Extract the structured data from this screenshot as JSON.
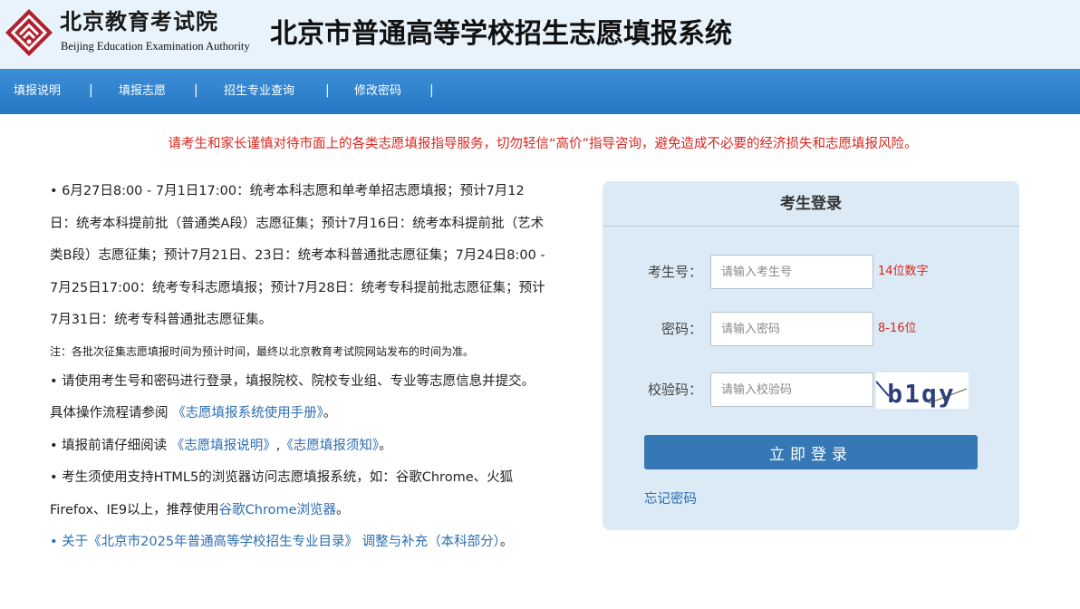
{
  "header": {
    "org_name_cn": "北京教育考试院",
    "org_name_en": "Beijing Education Examination Authority",
    "system_title": "北京市普通高等学校招生志愿填报系统",
    "logo_icon": "beijing-education-exam-logo-icon",
    "logo_color": "#b0212e"
  },
  "nav": {
    "items": [
      {
        "label": "填报说明"
      },
      {
        "label": "填报志愿"
      },
      {
        "label": "招生专业查询"
      },
      {
        "label": "修改密码"
      }
    ],
    "separator": "|",
    "background": "#2a7dc9"
  },
  "warning": "请考生和家长谨慎对待市面上的各类志愿填报指导服务，切勿轻信“高价”指导咨询，避免造成不必要的经济损失和志愿填报风险。",
  "notes": {
    "schedule": "• 6月27日8:00 - 7月1日17:00：统考本科志愿和单考单招志愿填报；预计7月12日：统考本科提前批（普通类A段）志愿征集；预计7月16日：统考本科提前批（艺术类B段）志愿征集；预计7月21日、23日：统考本科普通批志愿征集；7月24日8:00 - 7月25日17:00：统考专科志愿填报；预计7月28日：统考专科提前批志愿征集；预计7月31日：统考专科普通批志愿征集。",
    "note": "注：各批次征集志愿填报时间为预计时间，最终以北京教育考试院网站发布的时间为准。",
    "login_instruction_prefix": "• 请使用考生号和密码进行登录，填报院校、院校专业组、专业等志愿信息并提交。 具体操作流程请参阅 ",
    "manual_link": "《志愿填报系统使用手册》",
    "login_instruction_suffix": "。",
    "read_prefix": "• 填报前请仔细阅读 ",
    "read_link1": "《志愿填报说明》",
    "read_comma": ",",
    "read_link2": "《志愿填报须知》",
    "read_suffix": "。",
    "browser_prefix": "• 考生须使用支持HTML5的浏览器访问志愿填报系统，如：谷歌Chrome、火狐Firefox、IE9以上，推荐使用",
    "browser_link": "谷歌Chrome浏览器",
    "browser_suffix": "。",
    "catalog_link": "• 关于《北京市2025年普通高等学校招生专业目录》 调整与补充（本科部分）",
    "catalog_suffix": "。"
  },
  "login": {
    "title": "考生登录",
    "exam_id_label": "考生号：",
    "exam_id_placeholder": "请输入考生号",
    "exam_id_hint": "14位数字",
    "password_label": "密码：",
    "password_placeholder": "请输入密码",
    "password_hint": "8-16位",
    "captcha_label": "校验码：",
    "captcha_placeholder": "请输入校验码",
    "captcha_text": "b1qy",
    "submit_label": "立即登录",
    "forgot_label": "忘记密码"
  }
}
